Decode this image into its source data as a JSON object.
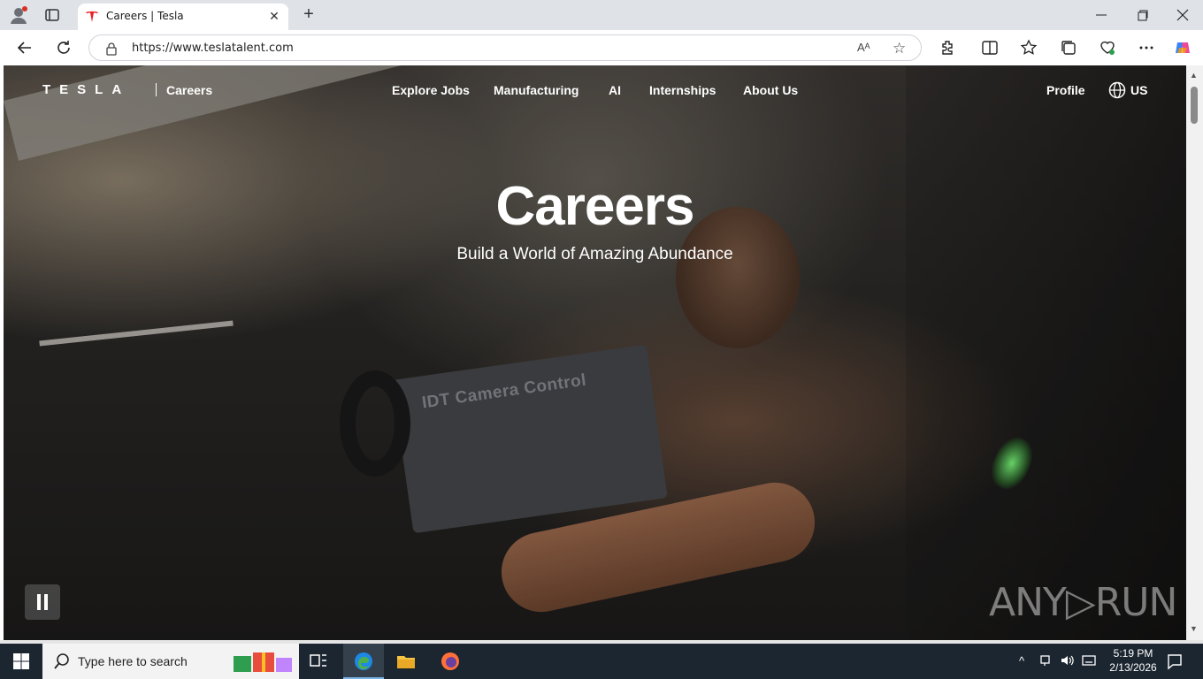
{
  "browser": {
    "tab_title": "Careers | Tesla",
    "tab_close": "✕",
    "new_tab": "+",
    "url": "https://www.teslatalent.com",
    "read_aloud": "Aᴬ",
    "favorite": "☆"
  },
  "site": {
    "logo": "TESLA",
    "section": "Careers",
    "nav": [
      "Explore Jobs",
      "Manufacturing",
      "AI",
      "Internships",
      "About Us"
    ],
    "profile": "Profile",
    "region": "US"
  },
  "hero": {
    "title": "Careers",
    "subtitle": "Build a World of Amazing Abundance",
    "screen_text": "IDT Camera Control"
  },
  "watermark": "ANY▷RUN",
  "taskbar": {
    "search_placeholder": "Type here to search",
    "time": "5:19 PM",
    "date": "2/13/2026"
  },
  "colors": {
    "tesla_red": "#e82127",
    "taskbar": "#1c2631",
    "titlebar": "#dfe3e8"
  }
}
